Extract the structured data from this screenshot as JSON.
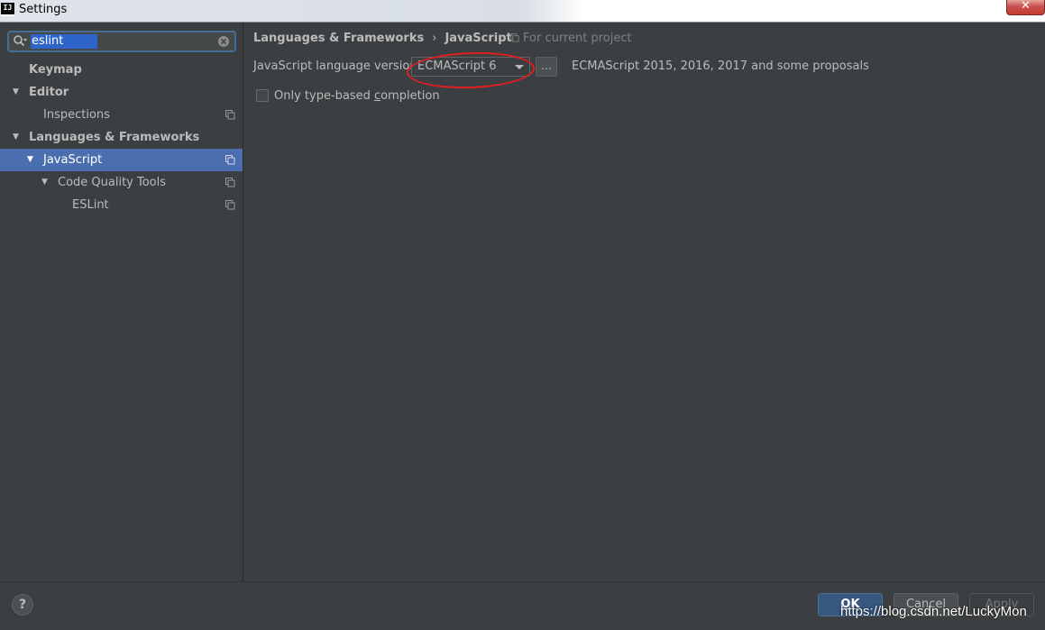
{
  "window": {
    "title": "Settings",
    "app_icon_text": "IJ",
    "close_glyph": "✕"
  },
  "search": {
    "value": "eslint"
  },
  "tree": [
    {
      "label": "Keymap"
    },
    {
      "label": "Editor"
    },
    {
      "label": "Inspections"
    },
    {
      "label": "Languages & Frameworks"
    },
    {
      "label": "JavaScript"
    },
    {
      "label": "Code Quality Tools"
    },
    {
      "label": "ESLint"
    }
  ],
  "breadcrumb": {
    "parent": "Languages & Frameworks",
    "separator": "›",
    "current": "JavaScript"
  },
  "scope": {
    "label": "For current project"
  },
  "language_version": {
    "label": "JavaScript language version",
    "selected": "ECMAScript 6",
    "more_label": "...",
    "description": "ECMAScript 2015, 2016, 2017 and some proposals"
  },
  "completion": {
    "label_prefix": "Only type-based ",
    "label_underlined": "c",
    "label_suffix": "ompletion",
    "checked": false
  },
  "footer": {
    "help_label": "?",
    "ok_mnemonic": "O",
    "ok_rest": "K",
    "cancel_label": "Cancel",
    "apply_mnemonic": "A",
    "apply_rest": "pply"
  },
  "watermark": "https://blog.csdn.net/LuckyMon",
  "colors": {
    "background": "#3c3f41",
    "selection": "#4b6eaf",
    "search_highlight": "#2f65ca",
    "annotation_red": "#e01e1e",
    "ok_button": "#365880"
  }
}
